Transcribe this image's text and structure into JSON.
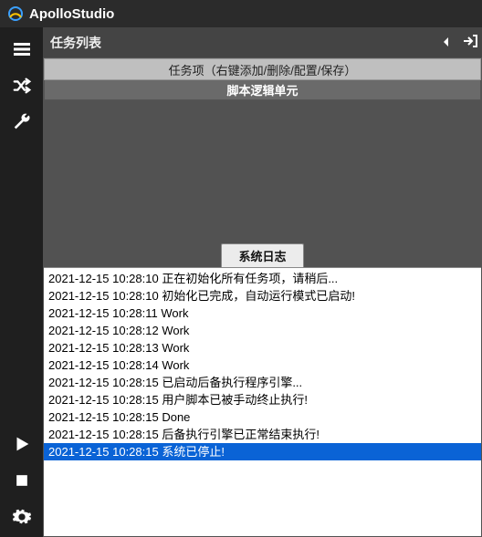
{
  "app": {
    "title": "ApolloStudio"
  },
  "sidebar": {
    "items": [
      {
        "name": "menu-icon"
      },
      {
        "name": "shuffle-icon"
      },
      {
        "name": "wrench-icon"
      }
    ],
    "bottom": [
      {
        "name": "play-icon"
      },
      {
        "name": "stop-icon"
      },
      {
        "name": "gear-icon"
      }
    ]
  },
  "panel": {
    "title": "任务列表",
    "collapse_label": "◂",
    "login_label": "➜]"
  },
  "tasks": {
    "header": "任务项（右键添加/删除/配置/保存）",
    "script_row": "脚本逻辑单元"
  },
  "log": {
    "tab_label": "系统日志",
    "lines": [
      {
        "text": "2021-12-15 10:28:10 正在初始化所有任务项，请稍后...",
        "selected": false
      },
      {
        "text": "2021-12-15 10:28:10 初始化已完成，自动运行模式已启动!",
        "selected": false
      },
      {
        "text": "2021-12-15 10:28:11 Work",
        "selected": false
      },
      {
        "text": "2021-12-15 10:28:12 Work",
        "selected": false
      },
      {
        "text": "2021-12-15 10:28:13 Work",
        "selected": false
      },
      {
        "text": "2021-12-15 10:28:14 Work",
        "selected": false
      },
      {
        "text": "2021-12-15 10:28:15 已启动后备执行程序引擎...",
        "selected": false
      },
      {
        "text": "2021-12-15 10:28:15 用户脚本已被手动终止执行!",
        "selected": false
      },
      {
        "text": "2021-12-15 10:28:15 Done",
        "selected": false
      },
      {
        "text": "2021-12-15 10:28:15 后备执行引擎已正常结束执行!",
        "selected": false
      },
      {
        "text": "2021-12-15 10:28:15 系统已停止!",
        "selected": true
      }
    ]
  }
}
